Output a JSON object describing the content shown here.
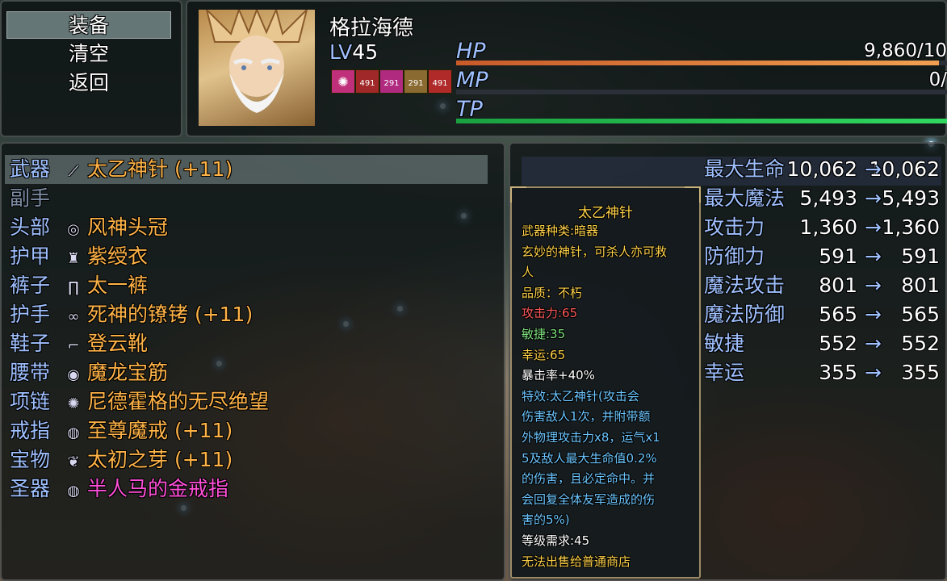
{
  "commands": [
    "装备",
    "清空",
    "返回"
  ],
  "actor": {
    "name": "格拉海德",
    "level_label": "LV",
    "level": "45",
    "state_icons": [
      "491",
      "291",
      "291",
      "491"
    ],
    "hp_label": "HP",
    "hp_value": "9,860/10",
    "hp_ratio": 0.98,
    "mp_label": "MP",
    "mp_value": "0/",
    "mp_ratio": 0,
    "tp_label": "TP",
    "tp_ratio": 1,
    "colors": {
      "hp": "#e0783a",
      "mp": "#6a6ad8",
      "tp": "#22c84a"
    }
  },
  "equipment": [
    {
      "slot": "武器",
      "icon": "needle-icon",
      "glyph": "⟋",
      "item": "太乙神针 (+11)",
      "color": "orange"
    },
    {
      "slot": "副手",
      "icon": "",
      "glyph": "",
      "item": "",
      "color": "orange"
    },
    {
      "slot": "头部",
      "icon": "circlet-icon",
      "glyph": "◎",
      "item": "风神头冠",
      "color": "orange"
    },
    {
      "slot": "护甲",
      "icon": "robe-icon",
      "glyph": "♜",
      "item": "紫绶衣",
      "color": "orange"
    },
    {
      "slot": "裤子",
      "icon": "pants-icon",
      "glyph": "∏",
      "item": "太一裤",
      "color": "orange"
    },
    {
      "slot": "护手",
      "icon": "shackle-icon",
      "glyph": "∞",
      "item": "死神的镣铐 (+11)",
      "color": "orange"
    },
    {
      "slot": "鞋子",
      "icon": "boot-icon",
      "glyph": "⌐",
      "item": "登云靴",
      "color": "orange"
    },
    {
      "slot": "腰带",
      "icon": "belt-icon",
      "glyph": "◉",
      "item": "魔龙宝筋",
      "color": "orange"
    },
    {
      "slot": "项链",
      "icon": "necklace-icon",
      "glyph": "✺",
      "item": "尼德霍格的无尽绝望",
      "color": "orange"
    },
    {
      "slot": "戒指",
      "icon": "ring-icon",
      "glyph": "◍",
      "item": "至尊魔戒 (+11)",
      "color": "orange"
    },
    {
      "slot": "宝物",
      "icon": "sprout-icon",
      "glyph": "❦",
      "item": "太初之芽 (+11)",
      "color": "orange"
    },
    {
      "slot": "圣器",
      "icon": "gold-ring-icon",
      "glyph": "◍",
      "item": "半人马的金戒指",
      "color": "pink"
    }
  ],
  "stats": [
    {
      "label": "最大生命",
      "current": "10,062",
      "new": "10,062"
    },
    {
      "label": "最大魔法",
      "current": "5,493",
      "new": "5,493"
    },
    {
      "label": "攻击力",
      "current": "1,360",
      "new": "1,360"
    },
    {
      "label": "防御力",
      "current": "591",
      "new": "591"
    },
    {
      "label": "魔法攻击",
      "current": "801",
      "new": "801"
    },
    {
      "label": "魔法防御",
      "current": "565",
      "new": "565"
    },
    {
      "label": "敏捷",
      "current": "552",
      "new": "552"
    },
    {
      "label": "幸运",
      "current": "355",
      "new": "355"
    }
  ],
  "arrow": "→",
  "tooltip": {
    "title": "太乙神针",
    "lines": [
      {
        "text": "武器种类:暗器",
        "color": "#ffd24a"
      },
      {
        "text": "玄妙的神针，可杀人亦可救",
        "color": "#ffd24a"
      },
      {
        "text": "人",
        "color": "#ffd24a"
      },
      {
        "text": "品质：不朽",
        "color": "#ffd24a"
      },
      {
        "text": "攻击力:65",
        "color": "#ff5a5a"
      },
      {
        "text": "敏捷:35",
        "color": "#7ee07e"
      },
      {
        "text": "幸运:65",
        "color": "#ffd24a"
      },
      {
        "text": "暴击率+40%",
        "color": "#ffffff"
      },
      {
        "text": "特效:太乙神针(攻击会",
        "color": "#6cc6ff"
      },
      {
        "text": "伤害敌人1次，并附带额",
        "color": "#6cc6ff"
      },
      {
        "text": "外物理攻击力x8，运气x1",
        "color": "#6cc6ff"
      },
      {
        "text": "5及敌人最大生命值0.2%",
        "color": "#6cc6ff"
      },
      {
        "text": "的伤害，且必定命中。并",
        "color": "#6cc6ff"
      },
      {
        "text": "会回复全体友军造成的伤",
        "color": "#6cc6ff"
      },
      {
        "text": "害的5%)",
        "color": "#6cc6ff"
      },
      {
        "text": "等级需求:45",
        "color": "#ffffff"
      },
      {
        "text": "无法出售给普通商店",
        "color": "#ffd24a"
      }
    ]
  }
}
